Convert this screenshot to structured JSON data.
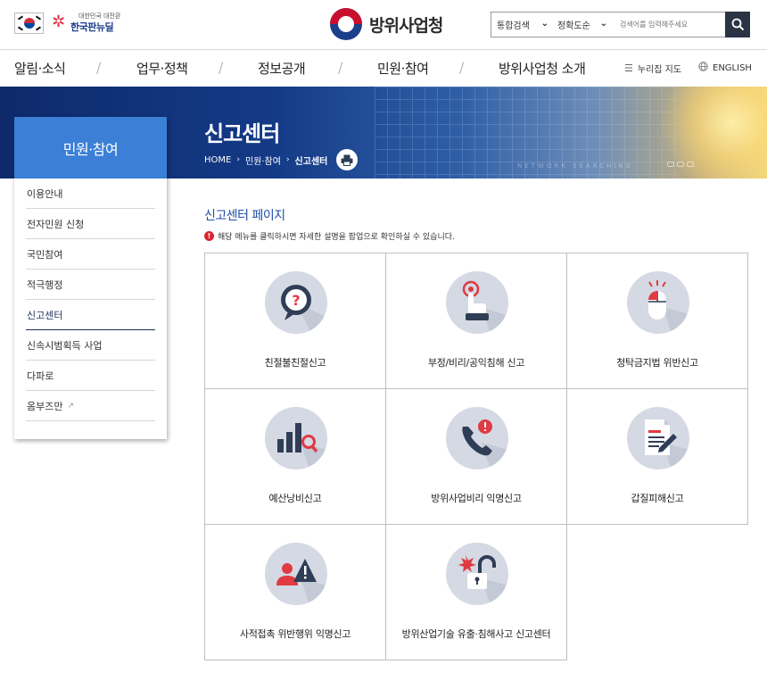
{
  "header": {
    "newdeal_small": "대한민국 대전환",
    "newdeal_big": "한국판뉴딜",
    "agency_name": "방위사업청",
    "search": {
      "scope": "통합검색",
      "sort": "정확도순",
      "placeholder": "검색어를 입력해주세요"
    }
  },
  "gnb": {
    "items": [
      "알림·소식",
      "업무·정책",
      "정보공개",
      "민원·참여",
      "방위사업청 소개"
    ],
    "sitemap": "누리집 지도",
    "english": "ENGLISH"
  },
  "banner": {
    "title": "신고센터",
    "breadcrumb": [
      "HOME",
      "민원·참여",
      "신고센터"
    ],
    "faint_text": "NETWORK SEARCHING"
  },
  "lnb": {
    "title": "민원·참여",
    "items": [
      {
        "label": "이용안내"
      },
      {
        "label": "전자민원 신청"
      },
      {
        "label": "국민참여"
      },
      {
        "label": "적극행정"
      },
      {
        "label": "신고센터"
      },
      {
        "label": "신속시범획득 사업"
      },
      {
        "label": "다파로"
      },
      {
        "label": "옴부즈만"
      }
    ]
  },
  "content": {
    "section_title": "신고센터 페이지",
    "note": "해당 메뉴를 클릭하시면 자세한 설명을 팝업으로 확인하실 수 있습니다.",
    "cards": [
      {
        "label": "친절불친절신고",
        "icon": "question-bubble-icon"
      },
      {
        "label": "부정/비리/공익침해 신고",
        "icon": "hand-press-icon"
      },
      {
        "label": "청탁금지법 위반신고",
        "icon": "mouse-alert-icon"
      },
      {
        "label": "예산낭비신고",
        "icon": "bar-chart-search-icon"
      },
      {
        "label": "방위사업비리 익명신고",
        "icon": "phone-alert-icon"
      },
      {
        "label": "갑질피해신고",
        "icon": "document-pen-icon"
      },
      {
        "label": "사적접촉 위반행위 익명신고",
        "icon": "person-warning-icon"
      },
      {
        "label": "방위산업기술 유출·침해사고 신고센터",
        "icon": "broken-lock-icon"
      }
    ]
  },
  "colors": {
    "lnb_head": "#3b7fd7",
    "banner_dark": "#0e2a6b",
    "section_title": "#1f4ea8",
    "icon_circle": "#d4d9e3",
    "icon_dark": "#2f3e56",
    "alert_red": "#e03a43"
  }
}
